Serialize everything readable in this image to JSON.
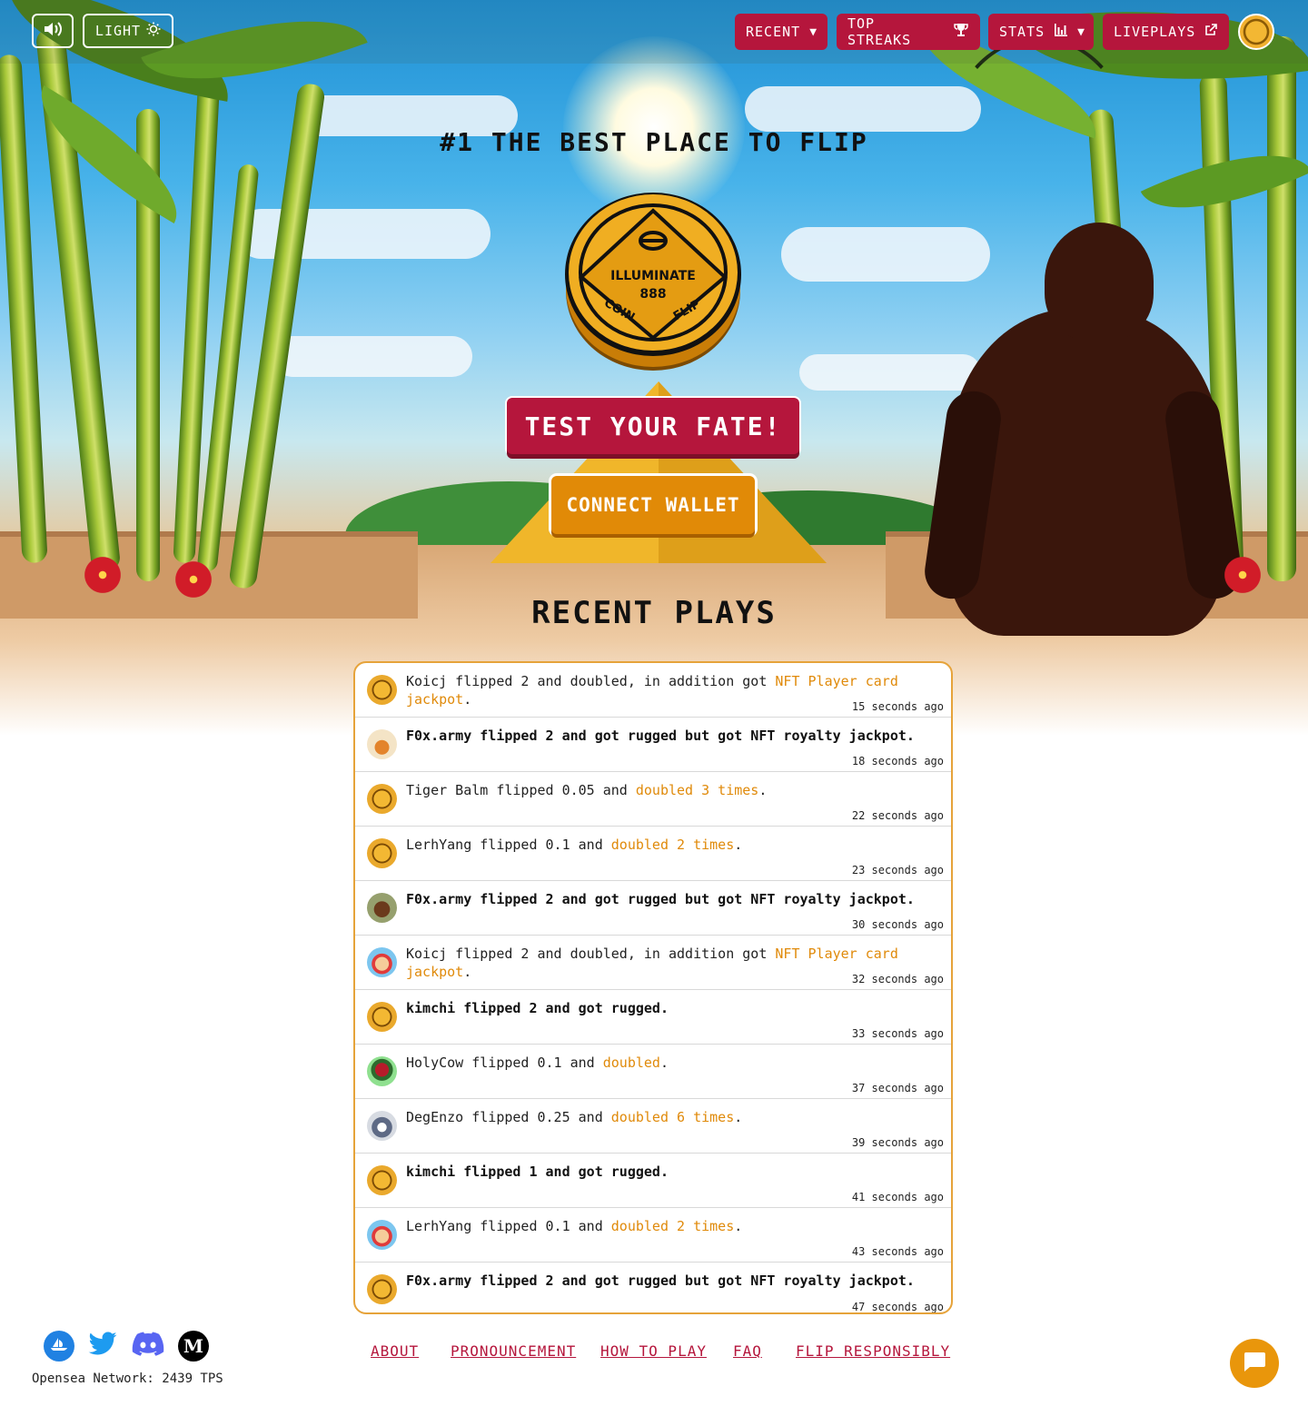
{
  "nav": {
    "light_label": "LIGHT",
    "recent_label": "RECENT",
    "top_streaks_label": "TOP STREAKS",
    "stats_label": "STATS",
    "liveplays_label": "LIVEPLAYS"
  },
  "hero": {
    "headline": "#1 THE BEST PLACE TO FLIP",
    "coin_text_top": "ILLUMINATE",
    "coin_text_mid": "888",
    "coin_text_left": "COIN",
    "coin_text_right": "FLIP",
    "cta_label": "TEST YOUR FATE!",
    "connect_label": "CONNECT WALLET"
  },
  "recent": {
    "title": "RECENT PLAYS",
    "plays": [
      {
        "pre": "Koicj flipped 2 and doubled, in addition got ",
        "hl": "NFT Player card jackpot",
        "post": ".",
        "time": "15 seconds ago",
        "bold": false
      },
      {
        "pre": "F0x.army flipped 2 and got rugged but got NFT royalty jackpot.",
        "hl": "",
        "post": "",
        "time": "18 seconds ago",
        "bold": true
      },
      {
        "pre": "Tiger Balm flipped 0.05 and ",
        "hl": "doubled 3 times",
        "post": ".",
        "time": "22 seconds ago",
        "bold": false
      },
      {
        "pre": "LerhYang flipped 0.1 and ",
        "hl": "doubled 2 times",
        "post": ".",
        "time": "23 seconds ago",
        "bold": false
      },
      {
        "pre": "F0x.army flipped 2 and got rugged but got NFT royalty jackpot.",
        "hl": "",
        "post": "",
        "time": "30 seconds ago",
        "bold": true
      },
      {
        "pre": "Koicj flipped 2 and doubled, in addition got ",
        "hl": "NFT Player card jackpot",
        "post": ".",
        "time": "32 seconds ago",
        "bold": false
      },
      {
        "pre": "kimchi flipped 2 and got rugged.",
        "hl": "",
        "post": "",
        "time": "33 seconds ago",
        "bold": true
      },
      {
        "pre": "HolyCow flipped 0.1 and ",
        "hl": "doubled",
        "post": ".",
        "time": "37 seconds ago",
        "bold": false
      },
      {
        "pre": "DegEnzo flipped 0.25 and ",
        "hl": "doubled 6 times",
        "post": ".",
        "time": "39 seconds ago",
        "bold": false
      },
      {
        "pre": "kimchi flipped 1 and got rugged.",
        "hl": "",
        "post": "",
        "time": "41 seconds ago",
        "bold": true
      },
      {
        "pre": "LerhYang flipped 0.1 and ",
        "hl": "doubled 2 times",
        "post": ".",
        "time": "43 seconds ago",
        "bold": false
      },
      {
        "pre": "F0x.army flipped 2 and got rugged but got NFT royalty jackpot.",
        "hl": "",
        "post": "",
        "time": "47 seconds ago",
        "bold": true
      }
    ]
  },
  "footer": {
    "network_status": "Opensea Network: 2439 TPS",
    "links": [
      "ABOUT",
      "PRONOUNCEMENT",
      "HOW TO PLAY",
      "FAQ",
      "FLIP RESPONSIBLY"
    ]
  },
  "colors": {
    "accent_red": "#b5163c",
    "accent_orange": "#e18a07",
    "highlight_text": "#e08a0a",
    "list_border": "#e6a33a"
  },
  "icons": [
    "speaker-icon",
    "sun-icon",
    "caret-down-icon",
    "trophy-icon",
    "bar-chart-icon",
    "external-link-icon",
    "opensea-icon",
    "twitter-icon",
    "discord-icon",
    "medium-icon",
    "chat-icon"
  ]
}
